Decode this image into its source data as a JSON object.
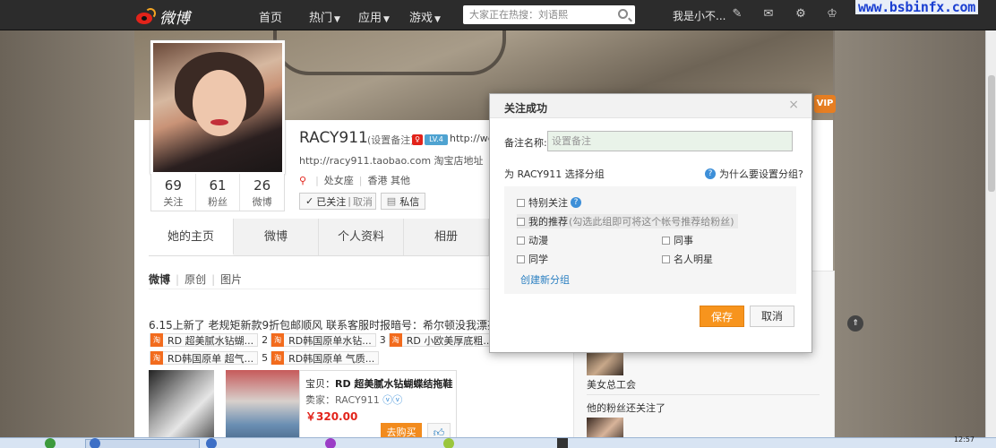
{
  "nav": {
    "logo_text": "微博",
    "items": [
      {
        "label": "首页",
        "dropdown": false
      },
      {
        "label": "热门",
        "dropdown": true
      },
      {
        "label": "应用",
        "dropdown": true
      },
      {
        "label": "游戏",
        "dropdown": true
      }
    ],
    "search_placeholder": "大家正在热搜：刘语熙",
    "username": "我是小不...",
    "icons": [
      "edit-icon",
      "message-icon",
      "gear-icon",
      "bell-icon"
    ],
    "watermark": "www.bsbinfx.com"
  },
  "profile": {
    "stats": [
      {
        "num": "69",
        "label": "关注"
      },
      {
        "num": "61",
        "label": "粉丝"
      },
      {
        "num": "26",
        "label": "微博"
      }
    ],
    "name": "RACY911",
    "note_link": "(设置备注)",
    "level_badge": "LV.4",
    "url_text": "http://weib",
    "desc": "http://racy911.taobao.com 淘宝店地址",
    "tags": [
      "处女座",
      "香港 其他"
    ],
    "follow_label": "已关注",
    "unfollow_label": "取消",
    "msg_label": "私信",
    "vip_badge": "VIP",
    "tabs": [
      "她的主页",
      "微博",
      "个人资料",
      "相册"
    ],
    "subtabs": [
      "微博",
      "原创",
      "图片"
    ]
  },
  "feed": {
    "post_text": "6.15上新了 老规矩新款9折包邮顺风 联系客服时报暗号：希尔顿没我漂亮 1",
    "chips_row1": [
      {
        "num": "",
        "text": "RD 超美腻水钻蝴..."
      },
      {
        "num": "2",
        "text": "RD韩国原单水钻..."
      },
      {
        "num": "3",
        "text": "RD 小欧美厚底粗..."
      }
    ],
    "chips_row2": [
      {
        "num": "",
        "text": "RD韩国原单 超气..."
      },
      {
        "num": "5",
        "text": "RD韩国原单 气质..."
      }
    ],
    "taobao_tag": "淘",
    "product": {
      "title_prefix": "宝贝：",
      "title": "RD 超美腻水钻蝴蝶结拖鞋~",
      "seller_prefix": "卖家：",
      "seller": "RACY911",
      "price": "￥320.00",
      "buy_label": "去购买"
    }
  },
  "rightcol": {
    "member_name": "美女总工会",
    "section_title": "他的粉丝还关注了"
  },
  "modal": {
    "title": "关注成功",
    "note_label": "备注名称:",
    "note_placeholder": "设置备注",
    "group_prompt": "为 RACY911 选择分组",
    "why_text": "为什么要设置分组?",
    "options": [
      {
        "label": "特别关注",
        "hint": "",
        "checked": false
      },
      {
        "label": "我的推荐",
        "hint": "(勾选此组即可将这个帐号推荐给粉丝)",
        "checked": false
      },
      {
        "label": "动漫",
        "hint": "",
        "checked": false
      },
      {
        "label": "同事",
        "hint": "",
        "checked": false
      },
      {
        "label": "同学",
        "hint": "",
        "checked": false
      },
      {
        "label": "名人明星",
        "hint": "",
        "checked": false
      }
    ],
    "create_group": "创建新分组",
    "save_label": "保存",
    "cancel_label": "取消"
  },
  "taskbar": {
    "clock": "12:57"
  },
  "colors": {
    "accent_orange": "#f7941d",
    "link_blue": "#2a7fc1",
    "weibo_red": "#e2231a",
    "nav_bg": "#2c2c2c"
  }
}
